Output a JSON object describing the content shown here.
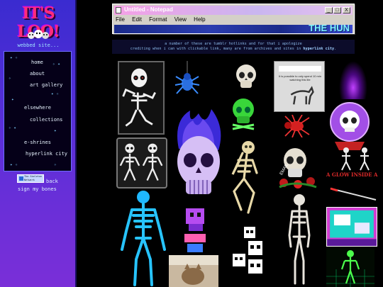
{
  "sidebar": {
    "title": "IT'S LOO!",
    "subtitle": "webbed site...",
    "nav": [
      {
        "label": "home"
      },
      {
        "label": "about"
      },
      {
        "label": "art gallery"
      },
      {
        "label": "elsewhere"
      },
      {
        "label": "collections"
      },
      {
        "label": "e-shrines"
      },
      {
        "label": "hyperlink city"
      }
    ],
    "badge_text": "The Skeleton Network",
    "back": "back",
    "guestbook": "sign my bones"
  },
  "notepad": {
    "title": "Untitled - Notepad",
    "menu": [
      "File",
      "Edit",
      "Format",
      "View",
      "Help"
    ],
    "banner": "THE HUN",
    "buttons": {
      "minimize": "_",
      "maximize": "□",
      "close": "X"
    }
  },
  "disclaimer": {
    "line1": "a number of these are tumblr hotlinks and for that i apologize",
    "line2_prefix": "crediting when i can with clickable link, many are from archives and sites in",
    "link": "hyperlink city"
  },
  "gallery": {
    "captions": {
      "dog_text": "It is possible to only spend 10 min watching this lite",
      "email": "EMAIL",
      "glow": "A GLOW INSIDE A"
    }
  }
}
